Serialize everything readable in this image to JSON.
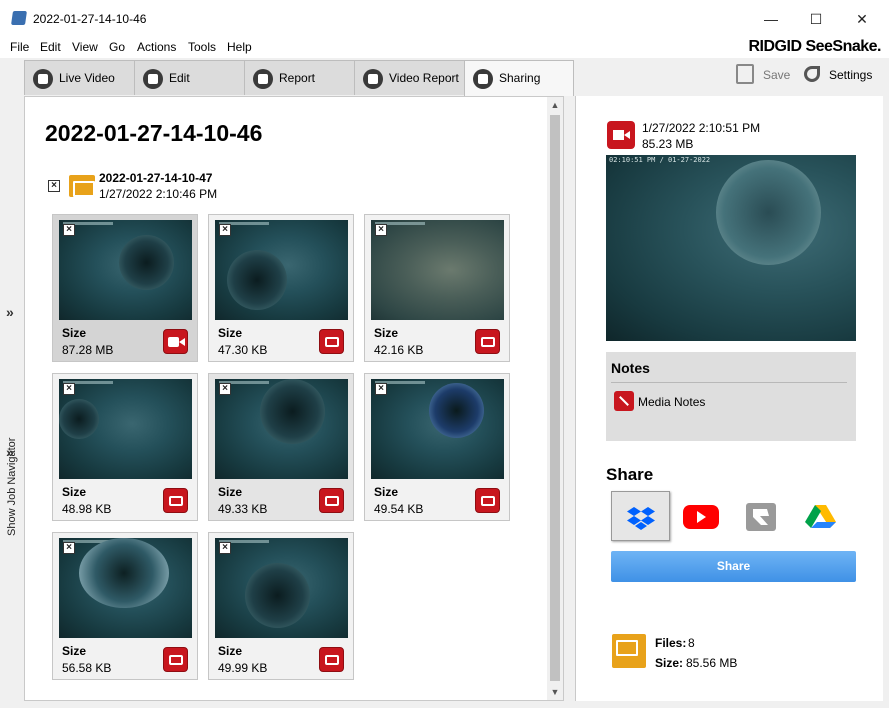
{
  "window": {
    "title": "2022-01-27-14-10-46",
    "minimize": "—",
    "maximize": "☐",
    "close": "✕"
  },
  "menu": [
    "File",
    "Edit",
    "View",
    "Go",
    "Actions",
    "Tools",
    "Help"
  ],
  "brand": "RIDGID SeeSnake.",
  "tabs": [
    {
      "label": "Live Video",
      "icon": "live-video-icon"
    },
    {
      "label": "Edit",
      "icon": "edit-icon"
    },
    {
      "label": "Report",
      "icon": "report-icon"
    },
    {
      "label": "Video Report",
      "icon": "video-report-icon"
    },
    {
      "label": "Sharing",
      "icon": "sharing-icon",
      "active": true
    }
  ],
  "toolbar": {
    "save": "Save",
    "settings": "Settings"
  },
  "navigator": {
    "label": "Show Job Navigator",
    "chevron": "»"
  },
  "job": {
    "title": "2022-01-27-14-10-46",
    "folder": {
      "name": "2022-01-27-14-10-47",
      "date": "1/27/2022 2:10:46 PM"
    }
  },
  "media": [
    {
      "size_label": "Size",
      "size": "87.28 MB",
      "kind": "video",
      "selected": true
    },
    {
      "size_label": "Size",
      "size": "47.30 KB",
      "kind": "photo"
    },
    {
      "size_label": "Size",
      "size": "42.16 KB",
      "kind": "photo"
    },
    {
      "size_label": "Size",
      "size": "48.98 KB",
      "kind": "photo"
    },
    {
      "size_label": "Size",
      "size": "49.33 KB",
      "kind": "photo",
      "hover": true
    },
    {
      "size_label": "Size",
      "size": "49.54 KB",
      "kind": "photo"
    },
    {
      "size_label": "Size",
      "size": "56.58 KB",
      "kind": "photo"
    },
    {
      "size_label": "Size",
      "size": "49.99 KB",
      "kind": "photo"
    }
  ],
  "detail": {
    "date": "1/27/2022 2:10:51 PM",
    "size": "85.23 MB",
    "preview_timestamp": "02:10:51 PM / 01-27-2022"
  },
  "notes": {
    "title": "Notes",
    "link": "Media Notes"
  },
  "share": {
    "title": "Share",
    "services": [
      "dropbox-icon",
      "youtube-icon",
      "ridgid-cloud-icon",
      "google-drive-icon"
    ],
    "button": "Share"
  },
  "stats": {
    "files_label": "Files:",
    "files": "8",
    "size_label": "Size:",
    "size": "85.56 MB"
  },
  "colors": {
    "accent_red": "#c8161e",
    "share_blue": "#4a9cec",
    "folder_orange": "#e8a21a",
    "dropbox_blue": "#0061fe",
    "youtube_red": "#ff0000"
  }
}
